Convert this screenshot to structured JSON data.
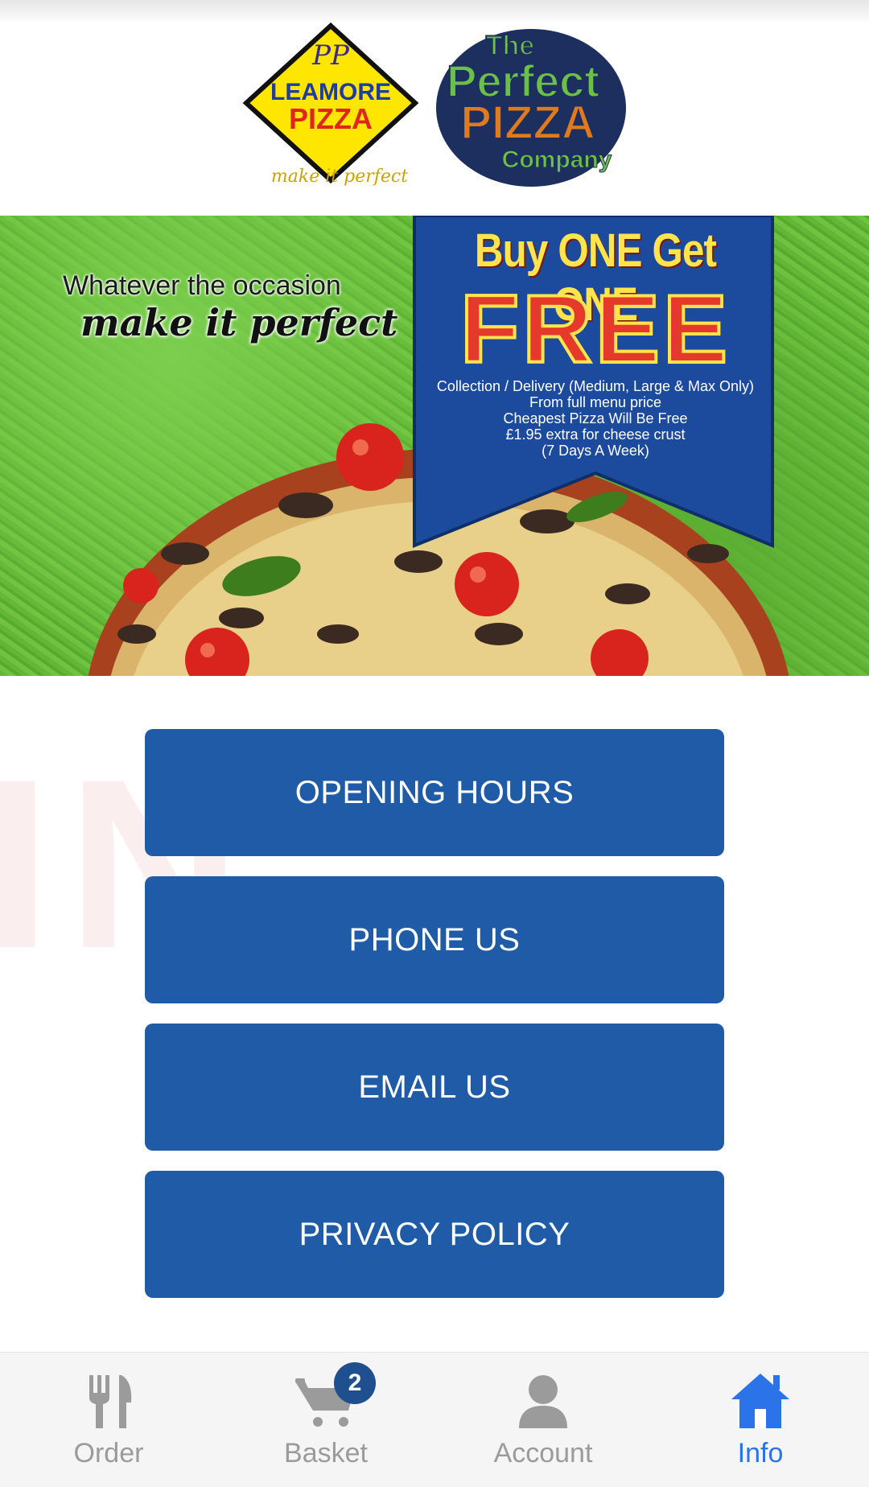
{
  "header": {
    "logo_left": {
      "line1": "LEAMORE",
      "line2": "PIZZA",
      "monogram": "PP",
      "tagline": "make it perfect"
    },
    "logo_right": {
      "line1": "The",
      "line2": "Perfect",
      "line3": "PIZZA",
      "line4": "Company"
    }
  },
  "banner": {
    "tagline_1": "Whatever the occasion",
    "tagline_2": "make it perfect",
    "offer_title": "Buy ONE Get ONE",
    "offer_free": "FREE",
    "offer_lines": [
      "Collection / Delivery (Medium, Large & Max Only)",
      "From full menu price",
      "Cheapest Pizza Will Be Free",
      "£1.95 extra for cheese crust",
      "(7 Days A Week)"
    ]
  },
  "buttons": {
    "opening_hours": "OPENING HOURS",
    "phone_us": "PHONE US",
    "email_us": "EMAIL US",
    "privacy_policy": "PRIVACY POLICY"
  },
  "tabbar": {
    "order": "Order",
    "basket": "Basket",
    "basket_count": "2",
    "account": "Account",
    "info": "Info",
    "active_tab": "Info",
    "active_color": "#2a73e8",
    "inactive_color": "#9b9b9b"
  },
  "colors": {
    "button_bg": "#1f5ba6",
    "badge_bg": "#1f4f8e"
  }
}
